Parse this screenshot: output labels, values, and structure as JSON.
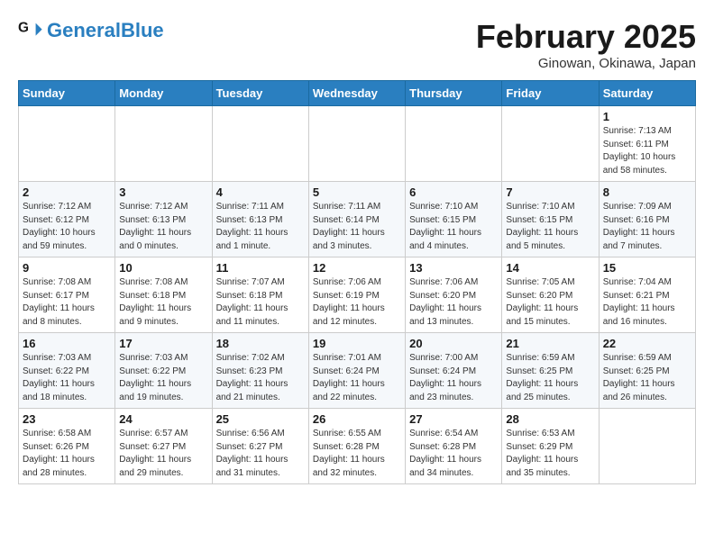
{
  "header": {
    "logo_general": "General",
    "logo_blue": "Blue",
    "month_title": "February 2025",
    "location": "Ginowan, Okinawa, Japan"
  },
  "weekdays": [
    "Sunday",
    "Monday",
    "Tuesday",
    "Wednesday",
    "Thursday",
    "Friday",
    "Saturday"
  ],
  "weeks": [
    [
      {
        "day": "",
        "info": ""
      },
      {
        "day": "",
        "info": ""
      },
      {
        "day": "",
        "info": ""
      },
      {
        "day": "",
        "info": ""
      },
      {
        "day": "",
        "info": ""
      },
      {
        "day": "",
        "info": ""
      },
      {
        "day": "1",
        "info": "Sunrise: 7:13 AM\nSunset: 6:11 PM\nDaylight: 10 hours\nand 58 minutes."
      }
    ],
    [
      {
        "day": "2",
        "info": "Sunrise: 7:12 AM\nSunset: 6:12 PM\nDaylight: 10 hours\nand 59 minutes."
      },
      {
        "day": "3",
        "info": "Sunrise: 7:12 AM\nSunset: 6:13 PM\nDaylight: 11 hours\nand 0 minutes."
      },
      {
        "day": "4",
        "info": "Sunrise: 7:11 AM\nSunset: 6:13 PM\nDaylight: 11 hours\nand 1 minute."
      },
      {
        "day": "5",
        "info": "Sunrise: 7:11 AM\nSunset: 6:14 PM\nDaylight: 11 hours\nand 3 minutes."
      },
      {
        "day": "6",
        "info": "Sunrise: 7:10 AM\nSunset: 6:15 PM\nDaylight: 11 hours\nand 4 minutes."
      },
      {
        "day": "7",
        "info": "Sunrise: 7:10 AM\nSunset: 6:15 PM\nDaylight: 11 hours\nand 5 minutes."
      },
      {
        "day": "8",
        "info": "Sunrise: 7:09 AM\nSunset: 6:16 PM\nDaylight: 11 hours\nand 7 minutes."
      }
    ],
    [
      {
        "day": "9",
        "info": "Sunrise: 7:08 AM\nSunset: 6:17 PM\nDaylight: 11 hours\nand 8 minutes."
      },
      {
        "day": "10",
        "info": "Sunrise: 7:08 AM\nSunset: 6:18 PM\nDaylight: 11 hours\nand 9 minutes."
      },
      {
        "day": "11",
        "info": "Sunrise: 7:07 AM\nSunset: 6:18 PM\nDaylight: 11 hours\nand 11 minutes."
      },
      {
        "day": "12",
        "info": "Sunrise: 7:06 AM\nSunset: 6:19 PM\nDaylight: 11 hours\nand 12 minutes."
      },
      {
        "day": "13",
        "info": "Sunrise: 7:06 AM\nSunset: 6:20 PM\nDaylight: 11 hours\nand 13 minutes."
      },
      {
        "day": "14",
        "info": "Sunrise: 7:05 AM\nSunset: 6:20 PM\nDaylight: 11 hours\nand 15 minutes."
      },
      {
        "day": "15",
        "info": "Sunrise: 7:04 AM\nSunset: 6:21 PM\nDaylight: 11 hours\nand 16 minutes."
      }
    ],
    [
      {
        "day": "16",
        "info": "Sunrise: 7:03 AM\nSunset: 6:22 PM\nDaylight: 11 hours\nand 18 minutes."
      },
      {
        "day": "17",
        "info": "Sunrise: 7:03 AM\nSunset: 6:22 PM\nDaylight: 11 hours\nand 19 minutes."
      },
      {
        "day": "18",
        "info": "Sunrise: 7:02 AM\nSunset: 6:23 PM\nDaylight: 11 hours\nand 21 minutes."
      },
      {
        "day": "19",
        "info": "Sunrise: 7:01 AM\nSunset: 6:24 PM\nDaylight: 11 hours\nand 22 minutes."
      },
      {
        "day": "20",
        "info": "Sunrise: 7:00 AM\nSunset: 6:24 PM\nDaylight: 11 hours\nand 23 minutes."
      },
      {
        "day": "21",
        "info": "Sunrise: 6:59 AM\nSunset: 6:25 PM\nDaylight: 11 hours\nand 25 minutes."
      },
      {
        "day": "22",
        "info": "Sunrise: 6:59 AM\nSunset: 6:25 PM\nDaylight: 11 hours\nand 26 minutes."
      }
    ],
    [
      {
        "day": "23",
        "info": "Sunrise: 6:58 AM\nSunset: 6:26 PM\nDaylight: 11 hours\nand 28 minutes."
      },
      {
        "day": "24",
        "info": "Sunrise: 6:57 AM\nSunset: 6:27 PM\nDaylight: 11 hours\nand 29 minutes."
      },
      {
        "day": "25",
        "info": "Sunrise: 6:56 AM\nSunset: 6:27 PM\nDaylight: 11 hours\nand 31 minutes."
      },
      {
        "day": "26",
        "info": "Sunrise: 6:55 AM\nSunset: 6:28 PM\nDaylight: 11 hours\nand 32 minutes."
      },
      {
        "day": "27",
        "info": "Sunrise: 6:54 AM\nSunset: 6:28 PM\nDaylight: 11 hours\nand 34 minutes."
      },
      {
        "day": "28",
        "info": "Sunrise: 6:53 AM\nSunset: 6:29 PM\nDaylight: 11 hours\nand 35 minutes."
      },
      {
        "day": "",
        "info": ""
      }
    ]
  ]
}
